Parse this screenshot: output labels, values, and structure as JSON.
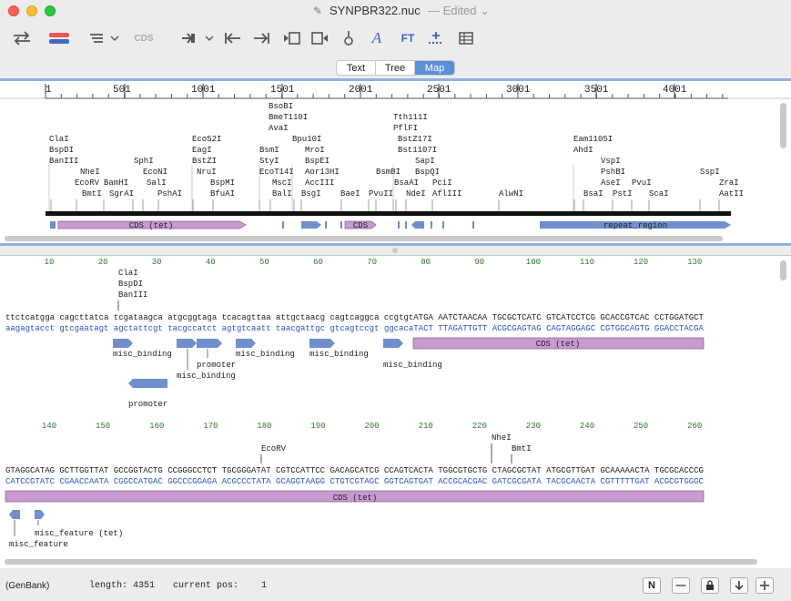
{
  "window": {
    "title": "SYNPBR322.nuc",
    "edited": "— Edited ⌄"
  },
  "toolbar": {
    "icons": [
      "swap-icon",
      "color-bar-icon",
      "list-dropdown-icon",
      "cds-icon",
      "translate-dropdown-icon",
      "jump-start-icon",
      "jump-end-icon",
      "prev-frame-icon",
      "next-frame-icon",
      "origin-icon",
      "font-icon",
      "ft-icon",
      "insert-icon",
      "table-icon"
    ],
    "cds_label": "CDS",
    "font_label": "A",
    "ft_label": "FT"
  },
  "tabs": [
    "Text",
    "Tree",
    "Map"
  ],
  "map": {
    "ruler_ticks": [
      "1",
      "501",
      "1001",
      "1501",
      "2001",
      "2501",
      "3001",
      "3501",
      "4001"
    ],
    "sites": [
      "ClaI",
      "BspDI",
      "BanIII",
      "NheI",
      "EcoRV",
      "BamHI",
      "BmtI",
      "SgrAI",
      "SphI",
      "EcoNI",
      "SalI",
      "PshAI",
      "Eco52I",
      "EagI",
      "BstZI",
      "NruI",
      "BspMI",
      "BfuAI",
      "BsoBI",
      "BmeT110I",
      "AvaI",
      "BsmI",
      "StyI",
      "EcoT14I",
      "MscI",
      "BalI",
      "Bpu10I",
      "MroI",
      "BspEI",
      "Aor13HI",
      "AccIII",
      "BsgI",
      "BaeI",
      "PvuII",
      "BsmBI",
      "Tth111I",
      "PflFI",
      "BstZ17I",
      "Bst1107I",
      "BsaAI",
      "SapI",
      "BspQI",
      "NdeI",
      "PciI",
      "AflIII",
      "AlwNI",
      "Eam1105I",
      "AhdI",
      "VspI",
      "PshBI",
      "AseI",
      "BsaI",
      "PstI",
      "PvuI",
      "ScaI",
      "SspI",
      "ZraI",
      "AatII"
    ],
    "features": [
      "CDS (tet)",
      "CDS",
      "repeat_region"
    ]
  },
  "seq": {
    "block1": {
      "ruler": [
        "10",
        "20",
        "30",
        "40",
        "50",
        "60",
        "70",
        "80",
        "90",
        "100",
        "110",
        "120",
        "130"
      ],
      "sites": [
        "ClaI",
        "BspDI",
        "BanIII"
      ],
      "top_lower": "ttctcatgga cagcttatca tcgataagca atgcggtaga tcacagttaa attgctaacg cagtcaggca ccgtgt",
      "top_upper": "ATGA AATCTAACAA TGCGCTCATC GTCATCCTCG GCACCGTCAC CCTGGATGCT",
      "bot_lower": "aagagtacct gtcgaatagt agctattcgt tacgccatct agtgtcaatt taacgattgc gtcagtccgt ggcaca",
      "bot_upper": "TACT TTAGATTGTT ACGCGAGTAG CAGTAGGAGC CGTGGCAGTG GGACCTACGA",
      "features": [
        "misc_binding",
        "promoter",
        "misc_binding",
        "misc_binding",
        "misc_binding",
        "misc_binding",
        "CDS (tet)",
        "promoter"
      ]
    },
    "block2": {
      "ruler": [
        "140",
        "150",
        "160",
        "170",
        "180",
        "190",
        "200",
        "210",
        "220",
        "230",
        "240",
        "250",
        "260"
      ],
      "sites": [
        "EcoRV",
        "NheI",
        "BmtI"
      ],
      "top": "GTAGGCATAG GCTTGGTTAT GCCGGTACTG CCGGGCCTCT TGCGGGATAT CGTCCATTCC GACAGCATCG CCAGTCACTA TGGCGTGCTG CTAGCGCTAT ATGCGTTGAT GCAAAAACTA TGCGCACCCG",
      "bot": "CATCCGTATC CGAACCAATA CGGCCATGAC GGCCCGGAGA ACGCCCTATA GCAGGTAAGG CTGTCGTAGC GGTCAGTGAT ACCGCACGAC GATCGCGATA TACGCAACTA CGTTTTTGAT ACGCGTGGGC",
      "features": [
        "CDS (tet)",
        "misc_feature (tet)",
        "misc_feature"
      ]
    }
  },
  "status": {
    "format": "(GenBank)",
    "length_label": "length:",
    "length": "4351",
    "pos_label": "current pos:",
    "pos": "1",
    "buttons": [
      "N",
      "—"
    ]
  },
  "colors": {
    "cds": "#c79ad0",
    "cds_border": "#8d5b96",
    "feature_blue": "#6f8fce",
    "dna_blue": "#2a55c8",
    "ruler_green": "#2c7a2c",
    "pane_border": "#8fb2dd"
  }
}
